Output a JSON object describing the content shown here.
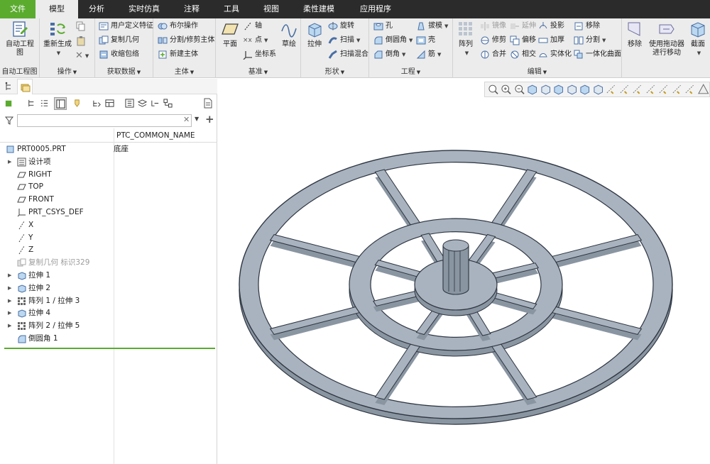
{
  "menu": {
    "tabs": [
      {
        "label": "文件"
      },
      {
        "label": "模型"
      },
      {
        "label": "分析"
      },
      {
        "label": "实时仿真"
      },
      {
        "label": "注释"
      },
      {
        "label": "工具"
      },
      {
        "label": "视图"
      },
      {
        "label": "柔性建模"
      },
      {
        "label": "应用程序"
      }
    ],
    "active": "模型"
  },
  "ribbon": {
    "groups": {
      "auto_drawing": {
        "label": "自动工程图",
        "big": "自动工程图"
      },
      "operations": {
        "label": "操作",
        "regenerate": "重新生成"
      },
      "get_data": {
        "label": "获取数据",
        "udf": "用户定义特征",
        "copy_geom": "复制几何",
        "shrinkwrap": "收缩包络"
      },
      "body": {
        "label": "主体",
        "boolean": "布尔操作",
        "split": "分割/修剪主体",
        "new_body": "新建主体"
      },
      "datum": {
        "label": "基准",
        "plane": "平面",
        "axis": "轴",
        "point": "点",
        "csys": "坐标系",
        "sketch": "草绘"
      },
      "shapes": {
        "label": "形状",
        "extrude": "拉伸",
        "revolve": "旋转",
        "sweep": "扫描",
        "swept_blend": "扫描混合"
      },
      "engineering": {
        "label": "工程",
        "hole": "孔",
        "round": "倒圆角",
        "chamfer": "倒角",
        "draft": "拔模",
        "shell": "壳",
        "rib": "筋"
      },
      "editing": {
        "label": "编辑",
        "pattern": "阵列",
        "mirror": "镜像",
        "extend": "延伸",
        "project": "投影",
        "trim": "修剪",
        "offset": "偏移",
        "thicken": "加厚",
        "merge": "合并",
        "intersect": "相交",
        "solidify": "实体化",
        "remove": "移除",
        "split": "分割",
        "unify_surface": "一体化曲面"
      },
      "extra": {
        "remove": "移除",
        "drag_move": "使用拖动器\n进行移动",
        "section": "截面"
      }
    }
  },
  "model_tree": {
    "column_header": "PTC_COMMON_NAME",
    "filter_placeholder": "",
    "items": [
      {
        "label": "PRT0005.PRT",
        "value": "底座",
        "icon": "part-icon",
        "indent": 0,
        "expand": false
      },
      {
        "label": "设计项",
        "icon": "design-items-icon",
        "indent": 1,
        "expand": true
      },
      {
        "label": "RIGHT",
        "icon": "datum-plane-icon",
        "indent": 1,
        "expand": false
      },
      {
        "label": "TOP",
        "icon": "datum-plane-icon",
        "indent": 1,
        "expand": false
      },
      {
        "label": "FRONT",
        "icon": "datum-plane-icon",
        "indent": 1,
        "expand": false
      },
      {
        "label": "PRT_CSYS_DEF",
        "icon": "csys-icon",
        "indent": 1,
        "expand": false
      },
      {
        "label": "X",
        "icon": "datum-axis-icon",
        "indent": 1,
        "expand": false
      },
      {
        "label": "Y",
        "icon": "datum-axis-icon",
        "indent": 1,
        "expand": false
      },
      {
        "label": "Z",
        "icon": "datum-axis-icon",
        "indent": 1,
        "expand": false
      },
      {
        "label": "复制几何 标识329",
        "icon": "copy-geometry-icon",
        "indent": 1,
        "expand": false,
        "muted": true
      },
      {
        "label": "拉伸 1",
        "icon": "extrude-icon",
        "indent": 1,
        "expand": true
      },
      {
        "label": "拉伸 2",
        "icon": "extrude-icon",
        "indent": 1,
        "expand": true
      },
      {
        "label": "阵列 1 / 拉伸 3",
        "icon": "pattern-icon",
        "indent": 1,
        "expand": true
      },
      {
        "label": "拉伸 4",
        "icon": "extrude-icon",
        "indent": 1,
        "expand": true
      },
      {
        "label": "阵列 2 / 拉伸 5",
        "icon": "pattern-icon",
        "indent": 1,
        "expand": true
      },
      {
        "label": "倒圆角 1",
        "icon": "round-icon",
        "indent": 1,
        "expand": false
      }
    ]
  },
  "colors": {
    "accent_green": "#5bab2f",
    "model_face": "#a9b3bf",
    "model_side": "#8a95a2",
    "model_edge": "#2d3540"
  }
}
